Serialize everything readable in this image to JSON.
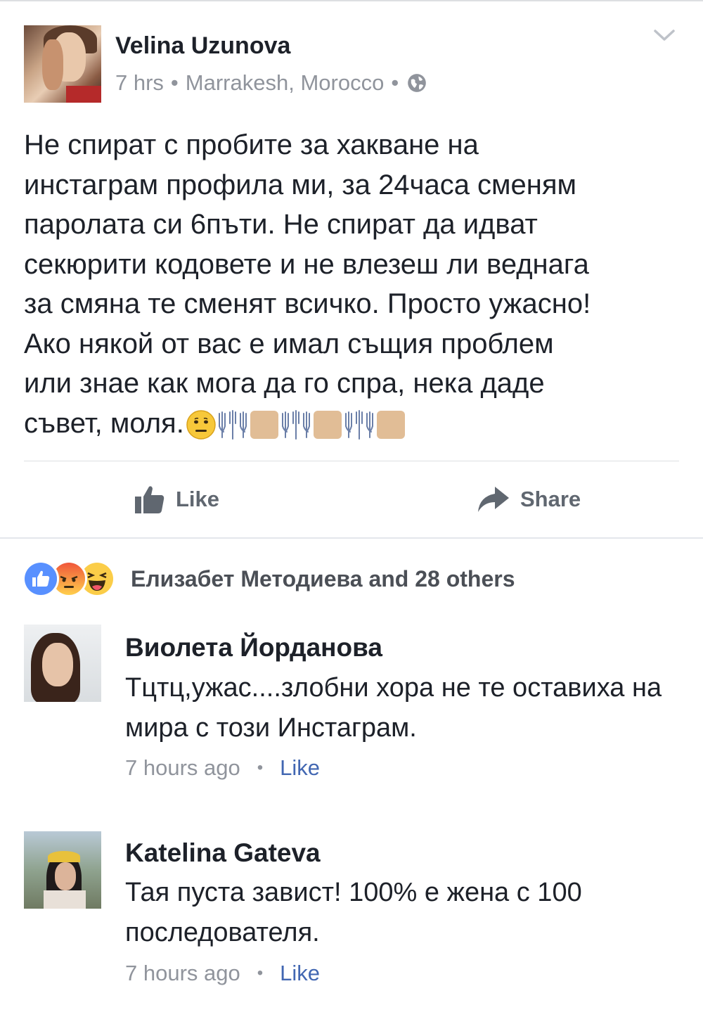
{
  "post": {
    "author": "Velina Uzunova",
    "time": "7 hrs",
    "separator": "•",
    "location": "Marrakesh, Morocco",
    "privacy_icon": "globe-icon",
    "menu_icon": "chevron-down-icon",
    "text": "Не спират с пробите за хакване на\nинстаграм профила ми, за 24часа сменям\nпаролата си 6пъти. Не спират да идват\nсекюрити кодовете и не влезеш ли веднага\nза смяна те сменят всичко. Просто ужасно!\nАко някой от вас е имал същия проблем\nили знае как мога да го спра, нека даде\nсъвет, моля.",
    "emojis": [
      "neutral-face-icon",
      "raising-hands-icon",
      "skin-tone-box",
      "raising-hands-icon",
      "skin-tone-box",
      "raising-hands-icon",
      "skin-tone-box"
    ]
  },
  "actions": {
    "like_label": "Like",
    "share_label": "Share"
  },
  "reactions": {
    "icons": [
      "like-reaction-icon",
      "angry-reaction-icon",
      "haha-reaction-icon"
    ],
    "summary": "Елизабет Методиева and 28 others"
  },
  "comments": [
    {
      "name": "Виолета Йорданова",
      "text": "Тцтц,ужас....злобни хора не те оставиха на мира с този Инстаграм.",
      "time": "7 hours ago",
      "separator": "•",
      "like_label": "Like"
    },
    {
      "name": "Katelina Gateva",
      "text": "Тая пуста завист! 100% е жена с 100 последователя.",
      "time": "7 hours ago",
      "separator": "•",
      "like_label": "Like"
    }
  ],
  "colors": {
    "link": "#4267b2",
    "meta": "#90949c",
    "text": "#1d2129"
  }
}
